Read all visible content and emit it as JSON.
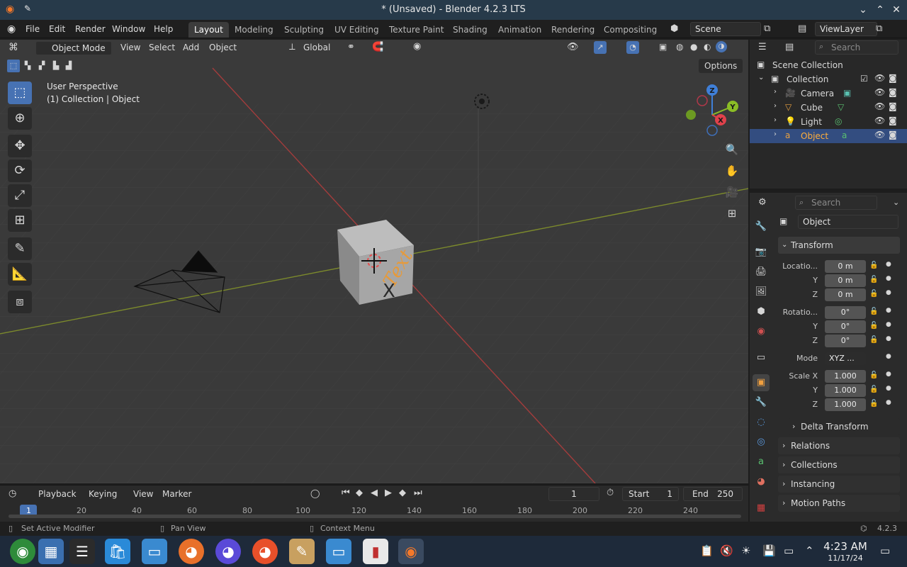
{
  "window": {
    "title": "* (Unsaved) - Blender 4.2.3 LTS"
  },
  "menu": [
    "File",
    "Edit",
    "Render",
    "Window",
    "Help"
  ],
  "workspaces": [
    "Layout",
    "Modeling",
    "Sculpting",
    "UV Editing",
    "Texture Paint",
    "Shading",
    "Animation",
    "Rendering",
    "Compositing"
  ],
  "scene": {
    "name": "Scene",
    "view_layer": "ViewLayer"
  },
  "viewport": {
    "mode": "Object Mode",
    "menus": [
      "View",
      "Select",
      "Add",
      "Object"
    ],
    "orientation": "Global",
    "options_label": "Options",
    "overlay_title": "User Perspective",
    "overlay_subtitle": "(1) Collection | Object",
    "cube_text": "Text",
    "gizmo": {
      "z": "Z",
      "y": "Y",
      "x": "X"
    }
  },
  "outliner": {
    "search_placeholder": "Search",
    "root": "Scene Collection",
    "collection": "Collection",
    "items": [
      "Camera",
      "Cube",
      "Light",
      "Object"
    ],
    "selected": "Object"
  },
  "properties": {
    "search_placeholder": "Search",
    "object_name": "Object",
    "transform_title": "Transform",
    "location_label": "Locatio...",
    "rotation_label": "Rotatio...",
    "y_label": "Y",
    "z_label": "Z",
    "loc_x": "0 m",
    "loc_y": "0 m",
    "loc_z": "0 m",
    "rot_x": "0°",
    "rot_y": "0°",
    "rot_z": "0°",
    "mode_label": "Mode",
    "mode_value": "XYZ ...",
    "scale_label": "Scale X",
    "scale_x": "1.000",
    "scale_y": "1.000",
    "scale_z": "1.000",
    "sections": [
      "Delta Transform",
      "Relations",
      "Collections",
      "Instancing",
      "Motion Paths"
    ]
  },
  "timeline": {
    "menus": [
      "Playback",
      "Keying",
      "View",
      "Marker"
    ],
    "current_frame": "1",
    "start_label": "Start",
    "start": "1",
    "end_label": "End",
    "end": "250",
    "ticks": [
      "1",
      "20",
      "40",
      "60",
      "80",
      "100",
      "120",
      "140",
      "160",
      "180",
      "200",
      "220",
      "240"
    ]
  },
  "status": {
    "left": "Set Active Modifier",
    "mid": "Pan View",
    "right": "Context Menu",
    "version": "4.2.3"
  },
  "taskbar": {
    "time": "4:23 AM",
    "date": "11/17/24"
  }
}
